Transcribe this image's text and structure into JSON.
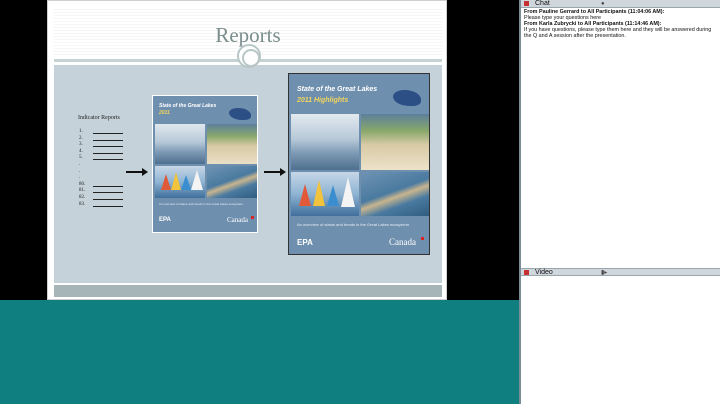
{
  "slide": {
    "title": "Reports",
    "indicator_title": "Indicator Reports",
    "indicator_rows": [
      "1.",
      "2.",
      "3.",
      "4.",
      "5.",
      ".",
      ".",
      ".",
      "80.",
      "81.",
      "82.",
      "83."
    ],
    "cover_small": {
      "title_line1": "State of the Great Lakes",
      "title_line2": "2011",
      "subtitle": "An overview of status and trends in the Great Lakes ecosystem",
      "epa": "EPA",
      "canada": "Canada"
    },
    "cover_large": {
      "title_line1": "State of the Great Lakes",
      "title_line2": "2011 Highlights",
      "subtitle": "An overview of status and trends in the Great Lakes ecosystem",
      "epa": "EPA",
      "canada": "Canada"
    }
  },
  "chat": {
    "title": "Chat",
    "messages": [
      {
        "from": "From Pauline Gerrard to All Participants (11:04:06 AM):",
        "text": "Please type your questions here"
      },
      {
        "from": "From Karla Zubrycki to All Participants (11:14:46 AM):",
        "text": "If you have  questions, please type them here and they will be answered during the Q and A session after the presentation."
      }
    ]
  },
  "video": {
    "title": "Video"
  },
  "colors": {
    "teal": "#0f7f7f",
    "slide_body": "#c5d2d9",
    "cover_blue": "#6f8fae",
    "title_gray": "#7a8c8c"
  },
  "icons": [
    "close-icon",
    "chat-bubble-icon",
    "camera-icon",
    "arrow-right-icon",
    "maple-leaf-icon"
  ]
}
